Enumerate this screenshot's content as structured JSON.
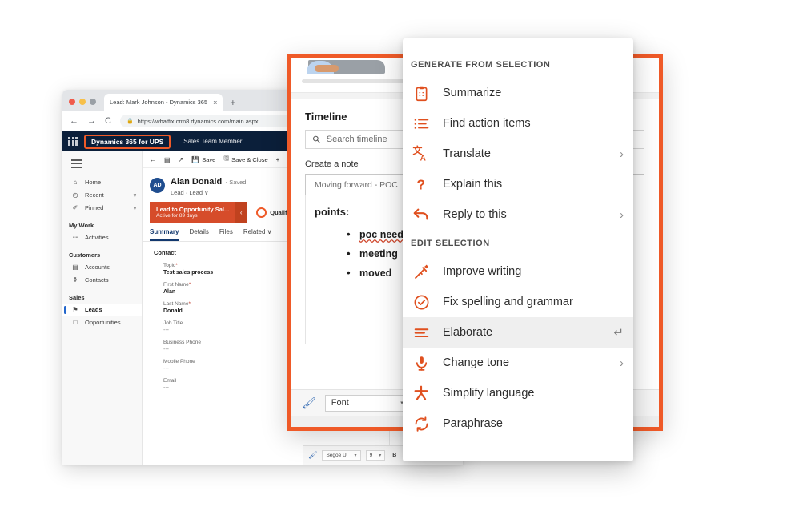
{
  "browser": {
    "tab_title": "Lead: Mark Johnson - Dynamics 365",
    "tab_close": "×",
    "new_tab": "+",
    "back": "←",
    "forward": "→",
    "reload": "C",
    "lock": "🔒",
    "url": "https://whatfix.crm8.dynamics.com/main.aspx"
  },
  "d365": {
    "app_name": "Dynamics 365 for UPS",
    "role": "Sales Team Member",
    "nav": [
      {
        "label": "Home",
        "icon": "home-icon",
        "glyph": "⌂",
        "chevron": ""
      },
      {
        "label": "Recent",
        "icon": "clock-icon",
        "glyph": "◴",
        "chevron": "∨"
      },
      {
        "label": "Pinned",
        "icon": "pin-icon",
        "glyph": "✐",
        "chevron": "∨"
      }
    ],
    "groups": [
      {
        "title": "My Work",
        "items": [
          {
            "label": "Activities",
            "icon": "activities-icon",
            "glyph": "☷",
            "selected": false
          }
        ]
      },
      {
        "title": "Customers",
        "items": [
          {
            "label": "Accounts",
            "icon": "accounts-icon",
            "glyph": "▤",
            "selected": false
          },
          {
            "label": "Contacts",
            "icon": "contacts-icon",
            "glyph": "⚱",
            "selected": false
          }
        ]
      },
      {
        "title": "Sales",
        "items": [
          {
            "label": "Leads",
            "icon": "leads-icon",
            "glyph": "⚑",
            "selected": true
          },
          {
            "label": "Opportunities",
            "icon": "opportunities-icon",
            "glyph": "□",
            "selected": false
          }
        ]
      }
    ],
    "commands": [
      {
        "label": "",
        "icon": "back-arrow-icon",
        "glyph": "←"
      },
      {
        "label": "",
        "icon": "form-icon",
        "glyph": "▤"
      },
      {
        "label": "",
        "icon": "open-new-icon",
        "glyph": "↗"
      },
      {
        "label": "Save",
        "icon": "save-icon",
        "glyph": "💾"
      },
      {
        "label": "Save & Close",
        "icon": "save-close-icon",
        "glyph": "🖫"
      },
      {
        "label": "",
        "icon": "new-icon",
        "glyph": "+"
      }
    ],
    "record": {
      "initials": "AD",
      "name": "Alan Donald",
      "saved": "- Saved",
      "subtitle": "Lead · Lead ∨"
    },
    "bpf": {
      "stage": "Lead to Opportunity Sal...",
      "active": "Active for 89 days",
      "arrow": "‹",
      "qualify": "Qualify"
    },
    "tabs": [
      {
        "label": "Summary",
        "active": true
      },
      {
        "label": "Details",
        "active": false
      },
      {
        "label": "Files",
        "active": false
      },
      {
        "label": "Related ∨",
        "active": false
      }
    ],
    "form": {
      "card_title": "Contact",
      "fields": [
        {
          "label": "Topic",
          "required": true,
          "value": "Test sales process",
          "empty": false
        },
        {
          "label": "First Name",
          "required": true,
          "value": "Alan",
          "empty": false
        },
        {
          "label": "Last Name",
          "required": true,
          "value": "Donald",
          "empty": false
        },
        {
          "label": "Job Title",
          "required": false,
          "value": "---",
          "empty": true
        },
        {
          "label": "Business Phone",
          "required": false,
          "value": "---",
          "empty": true
        },
        {
          "label": "Mobile Phone",
          "required": false,
          "value": "---",
          "empty": true
        },
        {
          "label": "Email",
          "required": false,
          "value": "---",
          "empty": true
        }
      ]
    },
    "back_font_toolbar": {
      "font_name": "Segoe UI",
      "font_size": "9",
      "bold": "B",
      "caret": "▾"
    }
  },
  "timeline": {
    "title": "Timeline",
    "search_placeholder": "Search timeline",
    "note_label": "Create a note",
    "note_subject": "Moving forward - POC",
    "body_lead": "points:",
    "bullets": [
      {
        "text": "poc need",
        "misspelled": true
      },
      {
        "text": "meeting",
        "misspelled": false
      },
      {
        "text": "moved",
        "misspelled": false
      }
    ],
    "font_toolbar": {
      "font_label": "Font",
      "caret": "▾"
    }
  },
  "context_menu": {
    "accent": "#e0501f",
    "sections": [
      {
        "header": "Generate from selection",
        "items": [
          {
            "label": "Summarize",
            "icon": "clipboard-icon",
            "submenu": false,
            "highlighted": false,
            "enter": false
          },
          {
            "label": "Find action items",
            "icon": "list-icon",
            "submenu": false,
            "highlighted": false,
            "enter": false
          },
          {
            "label": "Translate",
            "icon": "translate-icon",
            "submenu": true,
            "highlighted": false,
            "enter": false
          },
          {
            "label": "Explain this",
            "icon": "question-mark-icon",
            "submenu": false,
            "highlighted": false,
            "enter": false
          },
          {
            "label": "Reply to this",
            "icon": "reply-arrow-icon",
            "submenu": true,
            "highlighted": false,
            "enter": false
          }
        ]
      },
      {
        "header": "Edit selection",
        "items": [
          {
            "label": "Improve writing",
            "icon": "magic-wand-icon",
            "submenu": false,
            "highlighted": false,
            "enter": false
          },
          {
            "label": "Fix spelling and grammar",
            "icon": "check-circle-icon",
            "submenu": false,
            "highlighted": false,
            "enter": false
          },
          {
            "label": "Elaborate",
            "icon": "lines-icon",
            "submenu": false,
            "highlighted": true,
            "enter": true
          },
          {
            "label": "Change tone",
            "icon": "microphone-icon",
            "submenu": true,
            "highlighted": false,
            "enter": false
          },
          {
            "label": "Simplify language",
            "icon": "asterisk-icon",
            "submenu": false,
            "highlighted": false,
            "enter": false
          },
          {
            "label": "Paraphrase",
            "icon": "refresh-icon",
            "submenu": false,
            "highlighted": false,
            "enter": false
          }
        ]
      }
    ],
    "submenu_caret": "›",
    "enter_glyph": "↵"
  }
}
